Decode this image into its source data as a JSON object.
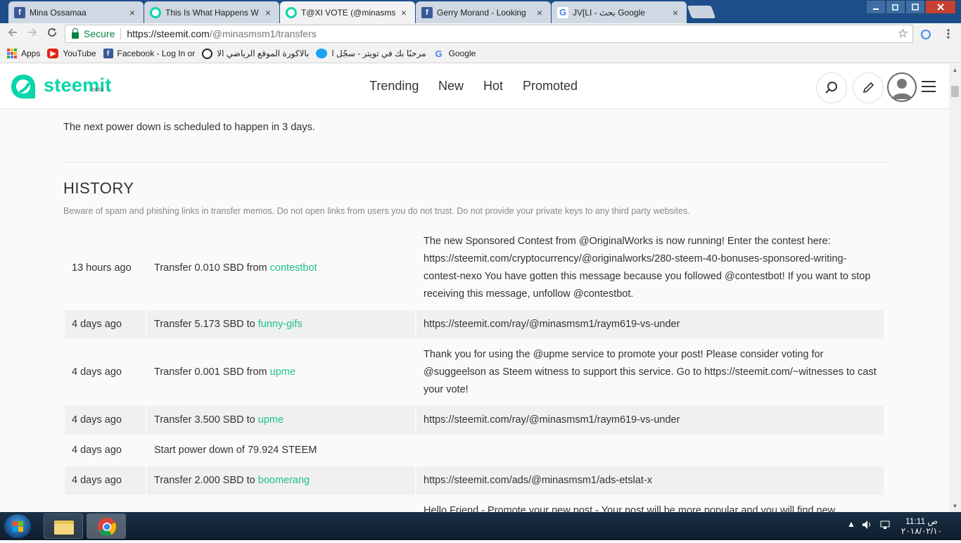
{
  "browser": {
    "tabs": [
      {
        "title": "Mina Ossamaa",
        "favicon": "facebook-icon"
      },
      {
        "title": "This Is What Happens W",
        "favicon": "steemit-icon"
      },
      {
        "title": "T@XI VOTE (@minasms",
        "favicon": "steemit-icon",
        "active": true
      },
      {
        "title": "Gerry Morand - Looking",
        "favicon": "facebook-icon"
      },
      {
        "title": "JV[LI - بحث Google",
        "favicon": "google-icon"
      }
    ],
    "close_glyph": "×",
    "secure_label": "Secure",
    "url_host": "https://steemit.com",
    "url_path": "/@minasmsm1/transfers",
    "bookmarks": [
      {
        "label": "Apps",
        "icon": "apps-grid-icon"
      },
      {
        "label": "YouTube",
        "icon": "youtube-icon"
      },
      {
        "label": "Facebook - Log In or",
        "icon": "facebook-icon"
      },
      {
        "label": "بالاكورة الموقع الرياضي الا",
        "icon": "football-icon"
      },
      {
        "label": "مرحبًا بك في تويتر - سجّل ا",
        "icon": "twitter-icon"
      },
      {
        "label": "Google",
        "icon": "google-icon"
      }
    ]
  },
  "steemit": {
    "logo_text": "steemit",
    "logo_beta": "beta",
    "nav": [
      "Trending",
      "New",
      "Hot",
      "Promoted"
    ],
    "accent_color": "#06d6a9"
  },
  "wallet": {
    "powerdown_text": "The next power down is scheduled to happen  in 3 days.",
    "history_title": "HISTORY",
    "history_warning": "Beware of spam and phishing links in transfer memos. Do not open links from users you do not trust. Do not provide your private keys to any third party websites.",
    "history": [
      {
        "time": "13 hours ago",
        "action": "Transfer 0.010 SBD from ",
        "account": "contestbot",
        "memo": "The new Sponsored Contest from @OriginalWorks is now running! Enter the contest here: https://steemit.com/cryptocurrency/@originalworks/280-steem-40-bonuses-sponsored-writing-contest-nexo You have gotten this message because you followed @contestbot! If you want to stop receiving this message, unfollow @contestbot."
      },
      {
        "time": "4 days ago",
        "action": "Transfer 5.173 SBD to ",
        "account": "funny-gifs",
        "memo": "https://steemit.com/ray/@minasmsm1/raym619-vs-under"
      },
      {
        "time": "4 days ago",
        "action": "Transfer 0.001 SBD from ",
        "account": "upme",
        "memo": "Thank you for using the @upme service to promote your post! Please consider voting for @suggeelson as Steem witness to support this service. Go to https://steemit.com/~witnesses to cast your vote!"
      },
      {
        "time": "4 days ago",
        "action": "Transfer 3.500 SBD to ",
        "account": "upme",
        "memo": "https://steemit.com/ray/@minasmsm1/raym619-vs-under"
      },
      {
        "time": "4 days ago",
        "action": "Start power down of 79.924 STEEM",
        "account": "",
        "memo": ""
      },
      {
        "time": "4 days ago",
        "action": "Transfer 2.000 SBD to ",
        "account": "boomerang",
        "memo": "https://steemit.com/ads/@minasmsm1/ads-etslat-x"
      },
      {
        "time": "",
        "action": "",
        "account": "",
        "memo": "Hello Friend - Promote your new post - Your post will be more popular and you will find new"
      }
    ]
  },
  "taskbar": {
    "clock_time": "11:11 ص",
    "clock_date": "٢٠١٨/٠٢/١٠"
  }
}
